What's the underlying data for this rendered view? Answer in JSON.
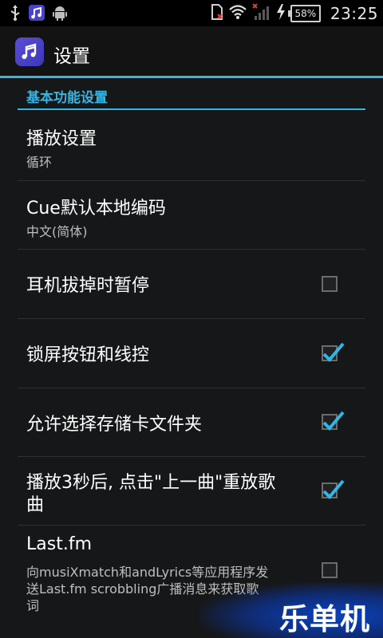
{
  "status_bar": {
    "left_icons": [
      "usb-icon",
      "music-app-icon",
      "android-icon"
    ],
    "right_icons": [
      "sim-error-icon",
      "wifi-icon",
      "signal-off-icon",
      "charging-icon"
    ],
    "battery": "58%",
    "time": "23:25"
  },
  "action_bar": {
    "title": "设置",
    "app_icon": "music-note-icon"
  },
  "category": {
    "title": "基本功能设置"
  },
  "prefs": [
    {
      "title": "播放设置",
      "summary": "循环"
    },
    {
      "title": "Cue默认本地编码",
      "summary": "中文(简体)"
    },
    {
      "title": "耳机拔掉时暂停",
      "checked": false
    },
    {
      "title": "锁屏按钮和线控",
      "checked": true
    },
    {
      "title": "允许选择存储卡文件夹",
      "checked": true
    },
    {
      "title_line1": "播放3秒后, 点击\"上一曲\"重放歌",
      "title_line2": "曲",
      "checked": true
    },
    {
      "title": "Last.fm",
      "summary_line1": "向musiXmatch和andLyrics等应用程序发",
      "summary_line2": "送Last.fm scrobbling广播消息来获取歌",
      "summary_line3": "词",
      "checked": false
    }
  ],
  "watermark": "乐单机",
  "colors": {
    "accent": "#33b5e5",
    "background": "#161718",
    "check": "#33b5e5"
  }
}
